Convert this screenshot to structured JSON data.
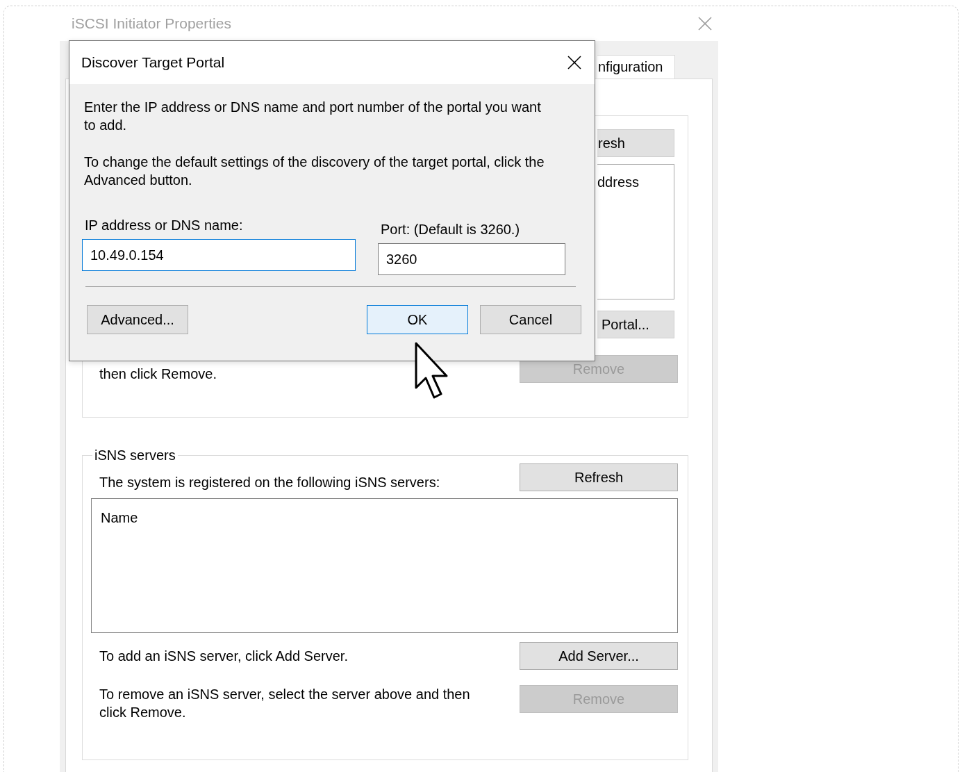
{
  "background_window": {
    "title": "iSCSI Initiator Properties",
    "tab": {
      "label": "nfiguration",
      "selected": true
    },
    "targets_group": {
      "refresh_button": "resh",
      "list_column": "ddress",
      "portal_button": "Portal...",
      "remove_text": "then click Remove.",
      "remove_button": {
        "label": "Remove",
        "disabled": true
      }
    },
    "isns_group": {
      "title": "iSNS servers",
      "description": "The system is registered on the following iSNS servers:",
      "refresh_button": {
        "label": "Refresh",
        "disabled": false
      },
      "list_columns": [
        "Name"
      ],
      "add_text": "To add an iSNS server, click Add Server.",
      "add_button": {
        "label": "Add Server...",
        "disabled": false
      },
      "remove_text": "To remove an iSNS server, select the server above and then click Remove.",
      "remove_button": {
        "label": "Remove",
        "disabled": true
      }
    }
  },
  "dialog": {
    "title": "Discover Target Portal",
    "paragraphs": [
      "Enter the IP address or DNS name and port number of the portal you want to add.",
      "To change the default settings of the discovery of the target portal, click the Advanced button."
    ],
    "ip_field": {
      "label": "IP address or DNS name:",
      "value": "10.49.0.154",
      "focused": true
    },
    "port_field": {
      "label": "Port: (Default is 3260.)",
      "value": "3260",
      "focused": false
    },
    "buttons": [
      {
        "label": "Advanced...",
        "default": false
      },
      {
        "label": "OK",
        "default": true
      },
      {
        "label": "Cancel",
        "default": false
      }
    ]
  }
}
